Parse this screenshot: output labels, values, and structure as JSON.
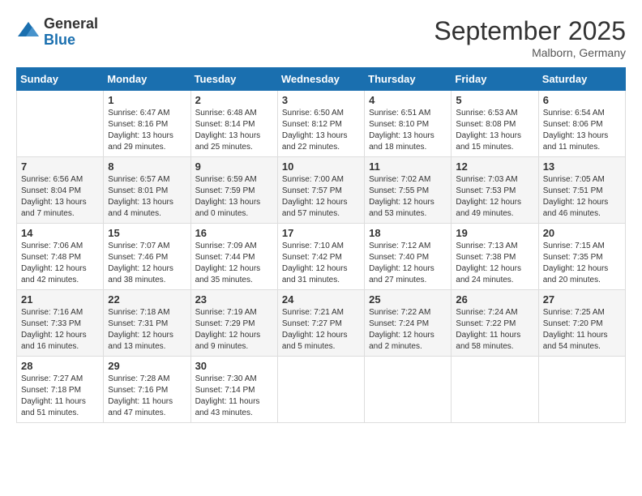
{
  "header": {
    "logo": {
      "general": "General",
      "blue": "Blue"
    },
    "title": "September 2025",
    "location": "Malborn, Germany"
  },
  "columns": [
    "Sunday",
    "Monday",
    "Tuesday",
    "Wednesday",
    "Thursday",
    "Friday",
    "Saturday"
  ],
  "weeks": [
    [
      {
        "day": "",
        "info": ""
      },
      {
        "day": "1",
        "info": "Sunrise: 6:47 AM\nSunset: 8:16 PM\nDaylight: 13 hours\nand 29 minutes."
      },
      {
        "day": "2",
        "info": "Sunrise: 6:48 AM\nSunset: 8:14 PM\nDaylight: 13 hours\nand 25 minutes."
      },
      {
        "day": "3",
        "info": "Sunrise: 6:50 AM\nSunset: 8:12 PM\nDaylight: 13 hours\nand 22 minutes."
      },
      {
        "day": "4",
        "info": "Sunrise: 6:51 AM\nSunset: 8:10 PM\nDaylight: 13 hours\nand 18 minutes."
      },
      {
        "day": "5",
        "info": "Sunrise: 6:53 AM\nSunset: 8:08 PM\nDaylight: 13 hours\nand 15 minutes."
      },
      {
        "day": "6",
        "info": "Sunrise: 6:54 AM\nSunset: 8:06 PM\nDaylight: 13 hours\nand 11 minutes."
      }
    ],
    [
      {
        "day": "7",
        "info": "Sunrise: 6:56 AM\nSunset: 8:04 PM\nDaylight: 13 hours\nand 7 minutes."
      },
      {
        "day": "8",
        "info": "Sunrise: 6:57 AM\nSunset: 8:01 PM\nDaylight: 13 hours\nand 4 minutes."
      },
      {
        "day": "9",
        "info": "Sunrise: 6:59 AM\nSunset: 7:59 PM\nDaylight: 13 hours\nand 0 minutes."
      },
      {
        "day": "10",
        "info": "Sunrise: 7:00 AM\nSunset: 7:57 PM\nDaylight: 12 hours\nand 57 minutes."
      },
      {
        "day": "11",
        "info": "Sunrise: 7:02 AM\nSunset: 7:55 PM\nDaylight: 12 hours\nand 53 minutes."
      },
      {
        "day": "12",
        "info": "Sunrise: 7:03 AM\nSunset: 7:53 PM\nDaylight: 12 hours\nand 49 minutes."
      },
      {
        "day": "13",
        "info": "Sunrise: 7:05 AM\nSunset: 7:51 PM\nDaylight: 12 hours\nand 46 minutes."
      }
    ],
    [
      {
        "day": "14",
        "info": "Sunrise: 7:06 AM\nSunset: 7:48 PM\nDaylight: 12 hours\nand 42 minutes."
      },
      {
        "day": "15",
        "info": "Sunrise: 7:07 AM\nSunset: 7:46 PM\nDaylight: 12 hours\nand 38 minutes."
      },
      {
        "day": "16",
        "info": "Sunrise: 7:09 AM\nSunset: 7:44 PM\nDaylight: 12 hours\nand 35 minutes."
      },
      {
        "day": "17",
        "info": "Sunrise: 7:10 AM\nSunset: 7:42 PM\nDaylight: 12 hours\nand 31 minutes."
      },
      {
        "day": "18",
        "info": "Sunrise: 7:12 AM\nSunset: 7:40 PM\nDaylight: 12 hours\nand 27 minutes."
      },
      {
        "day": "19",
        "info": "Sunrise: 7:13 AM\nSunset: 7:38 PM\nDaylight: 12 hours\nand 24 minutes."
      },
      {
        "day": "20",
        "info": "Sunrise: 7:15 AM\nSunset: 7:35 PM\nDaylight: 12 hours\nand 20 minutes."
      }
    ],
    [
      {
        "day": "21",
        "info": "Sunrise: 7:16 AM\nSunset: 7:33 PM\nDaylight: 12 hours\nand 16 minutes."
      },
      {
        "day": "22",
        "info": "Sunrise: 7:18 AM\nSunset: 7:31 PM\nDaylight: 12 hours\nand 13 minutes."
      },
      {
        "day": "23",
        "info": "Sunrise: 7:19 AM\nSunset: 7:29 PM\nDaylight: 12 hours\nand 9 minutes."
      },
      {
        "day": "24",
        "info": "Sunrise: 7:21 AM\nSunset: 7:27 PM\nDaylight: 12 hours\nand 5 minutes."
      },
      {
        "day": "25",
        "info": "Sunrise: 7:22 AM\nSunset: 7:24 PM\nDaylight: 12 hours\nand 2 minutes."
      },
      {
        "day": "26",
        "info": "Sunrise: 7:24 AM\nSunset: 7:22 PM\nDaylight: 11 hours\nand 58 minutes."
      },
      {
        "day": "27",
        "info": "Sunrise: 7:25 AM\nSunset: 7:20 PM\nDaylight: 11 hours\nand 54 minutes."
      }
    ],
    [
      {
        "day": "28",
        "info": "Sunrise: 7:27 AM\nSunset: 7:18 PM\nDaylight: 11 hours\nand 51 minutes."
      },
      {
        "day": "29",
        "info": "Sunrise: 7:28 AM\nSunset: 7:16 PM\nDaylight: 11 hours\nand 47 minutes."
      },
      {
        "day": "30",
        "info": "Sunrise: 7:30 AM\nSunset: 7:14 PM\nDaylight: 11 hours\nand 43 minutes."
      },
      {
        "day": "",
        "info": ""
      },
      {
        "day": "",
        "info": ""
      },
      {
        "day": "",
        "info": ""
      },
      {
        "day": "",
        "info": ""
      }
    ]
  ]
}
